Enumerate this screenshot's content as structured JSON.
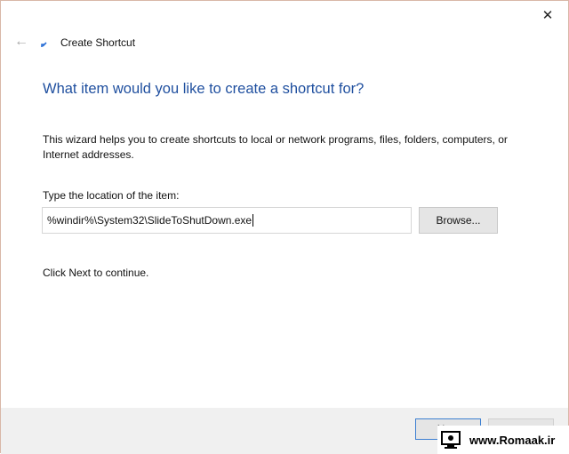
{
  "window": {
    "title": "Create Shortcut",
    "close_glyph": "✕",
    "back_glyph": "←"
  },
  "wizard": {
    "heading": "What item would you like to create a shortcut for?",
    "description": "This wizard helps you to create shortcuts to local or network programs, files, folders, computers, or Internet addresses.",
    "location_label": "Type the location of the item:",
    "location_value": "%windir%\\System32\\SlideToShutDown.exe",
    "browse_label": "Browse...",
    "continue_text": "Click Next to continue."
  },
  "footer": {
    "next_label": "Next",
    "cancel_label": ""
  },
  "watermark": {
    "text": "www.Romaak.ir"
  },
  "colors": {
    "heading": "#1f4f9f",
    "footer_bg": "#f0f0f0",
    "default_button_border": "#3c7fd1"
  }
}
